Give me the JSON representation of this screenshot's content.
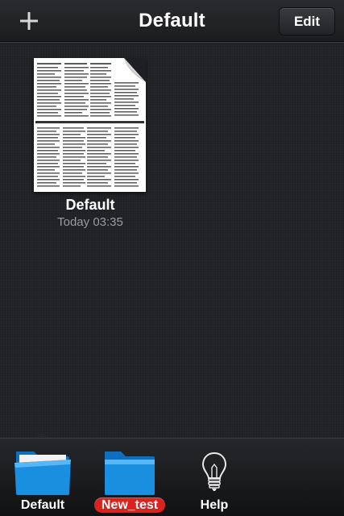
{
  "navbar": {
    "title": "Default",
    "edit_label": "Edit",
    "add_icon": "plus-icon"
  },
  "document": {
    "name": "Default",
    "date": "Today 03:35",
    "thumbnail_icon": "document-page-curl-icon"
  },
  "pager": {
    "pages": [
      "search",
      "page-1"
    ],
    "current": 1
  },
  "tabbar": {
    "tabs": [
      {
        "label": "Default",
        "icon": "folder-icon",
        "selected": true
      },
      {
        "label": "New_test",
        "icon": "folder-icon",
        "badge": true
      },
      {
        "label": "Help",
        "icon": "lightbulb-icon"
      }
    ]
  },
  "colors": {
    "folder_blue": "#1a8fe0",
    "badge_red": "#d8231f"
  }
}
